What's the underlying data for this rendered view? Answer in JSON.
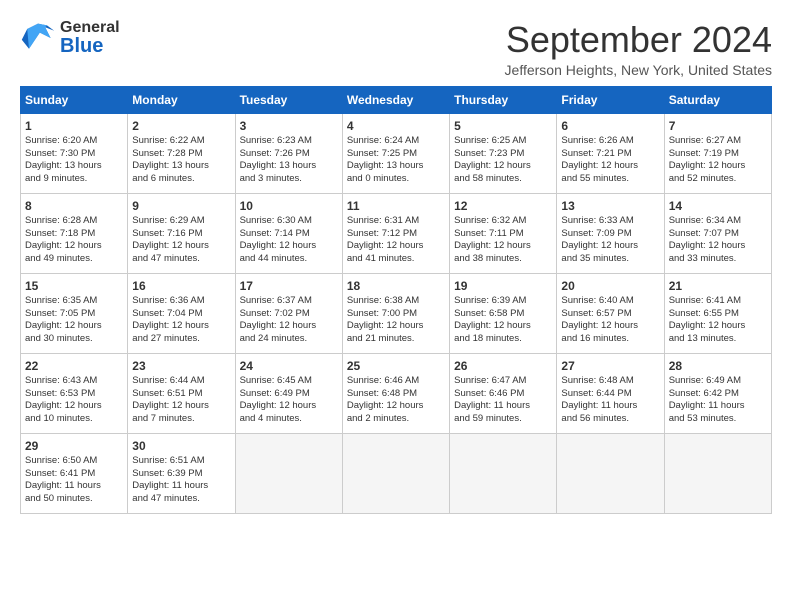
{
  "header": {
    "logo_general": "General",
    "logo_blue": "Blue",
    "month_title": "September 2024",
    "location": "Jefferson Heights, New York, United States"
  },
  "calendar": {
    "days_of_week": [
      "Sunday",
      "Monday",
      "Tuesday",
      "Wednesday",
      "Thursday",
      "Friday",
      "Saturday"
    ],
    "weeks": [
      [
        {
          "day": "1",
          "info": "Sunrise: 6:20 AM\nSunset: 7:30 PM\nDaylight: 13 hours\nand 9 minutes."
        },
        {
          "day": "2",
          "info": "Sunrise: 6:22 AM\nSunset: 7:28 PM\nDaylight: 13 hours\nand 6 minutes."
        },
        {
          "day": "3",
          "info": "Sunrise: 6:23 AM\nSunset: 7:26 PM\nDaylight: 13 hours\nand 3 minutes."
        },
        {
          "day": "4",
          "info": "Sunrise: 6:24 AM\nSunset: 7:25 PM\nDaylight: 13 hours\nand 0 minutes."
        },
        {
          "day": "5",
          "info": "Sunrise: 6:25 AM\nSunset: 7:23 PM\nDaylight: 12 hours\nand 58 minutes."
        },
        {
          "day": "6",
          "info": "Sunrise: 6:26 AM\nSunset: 7:21 PM\nDaylight: 12 hours\nand 55 minutes."
        },
        {
          "day": "7",
          "info": "Sunrise: 6:27 AM\nSunset: 7:19 PM\nDaylight: 12 hours\nand 52 minutes."
        }
      ],
      [
        {
          "day": "8",
          "info": "Sunrise: 6:28 AM\nSunset: 7:18 PM\nDaylight: 12 hours\nand 49 minutes."
        },
        {
          "day": "9",
          "info": "Sunrise: 6:29 AM\nSunset: 7:16 PM\nDaylight: 12 hours\nand 47 minutes."
        },
        {
          "day": "10",
          "info": "Sunrise: 6:30 AM\nSunset: 7:14 PM\nDaylight: 12 hours\nand 44 minutes."
        },
        {
          "day": "11",
          "info": "Sunrise: 6:31 AM\nSunset: 7:12 PM\nDaylight: 12 hours\nand 41 minutes."
        },
        {
          "day": "12",
          "info": "Sunrise: 6:32 AM\nSunset: 7:11 PM\nDaylight: 12 hours\nand 38 minutes."
        },
        {
          "day": "13",
          "info": "Sunrise: 6:33 AM\nSunset: 7:09 PM\nDaylight: 12 hours\nand 35 minutes."
        },
        {
          "day": "14",
          "info": "Sunrise: 6:34 AM\nSunset: 7:07 PM\nDaylight: 12 hours\nand 33 minutes."
        }
      ],
      [
        {
          "day": "15",
          "info": "Sunrise: 6:35 AM\nSunset: 7:05 PM\nDaylight: 12 hours\nand 30 minutes."
        },
        {
          "day": "16",
          "info": "Sunrise: 6:36 AM\nSunset: 7:04 PM\nDaylight: 12 hours\nand 27 minutes."
        },
        {
          "day": "17",
          "info": "Sunrise: 6:37 AM\nSunset: 7:02 PM\nDaylight: 12 hours\nand 24 minutes."
        },
        {
          "day": "18",
          "info": "Sunrise: 6:38 AM\nSunset: 7:00 PM\nDaylight: 12 hours\nand 21 minutes."
        },
        {
          "day": "19",
          "info": "Sunrise: 6:39 AM\nSunset: 6:58 PM\nDaylight: 12 hours\nand 18 minutes."
        },
        {
          "day": "20",
          "info": "Sunrise: 6:40 AM\nSunset: 6:57 PM\nDaylight: 12 hours\nand 16 minutes."
        },
        {
          "day": "21",
          "info": "Sunrise: 6:41 AM\nSunset: 6:55 PM\nDaylight: 12 hours\nand 13 minutes."
        }
      ],
      [
        {
          "day": "22",
          "info": "Sunrise: 6:43 AM\nSunset: 6:53 PM\nDaylight: 12 hours\nand 10 minutes."
        },
        {
          "day": "23",
          "info": "Sunrise: 6:44 AM\nSunset: 6:51 PM\nDaylight: 12 hours\nand 7 minutes."
        },
        {
          "day": "24",
          "info": "Sunrise: 6:45 AM\nSunset: 6:49 PM\nDaylight: 12 hours\nand 4 minutes."
        },
        {
          "day": "25",
          "info": "Sunrise: 6:46 AM\nSunset: 6:48 PM\nDaylight: 12 hours\nand 2 minutes."
        },
        {
          "day": "26",
          "info": "Sunrise: 6:47 AM\nSunset: 6:46 PM\nDaylight: 11 hours\nand 59 minutes."
        },
        {
          "day": "27",
          "info": "Sunrise: 6:48 AM\nSunset: 6:44 PM\nDaylight: 11 hours\nand 56 minutes."
        },
        {
          "day": "28",
          "info": "Sunrise: 6:49 AM\nSunset: 6:42 PM\nDaylight: 11 hours\nand 53 minutes."
        }
      ],
      [
        {
          "day": "29",
          "info": "Sunrise: 6:50 AM\nSunset: 6:41 PM\nDaylight: 11 hours\nand 50 minutes."
        },
        {
          "day": "30",
          "info": "Sunrise: 6:51 AM\nSunset: 6:39 PM\nDaylight: 11 hours\nand 47 minutes."
        },
        {
          "day": "",
          "info": ""
        },
        {
          "day": "",
          "info": ""
        },
        {
          "day": "",
          "info": ""
        },
        {
          "day": "",
          "info": ""
        },
        {
          "day": "",
          "info": ""
        }
      ]
    ]
  }
}
